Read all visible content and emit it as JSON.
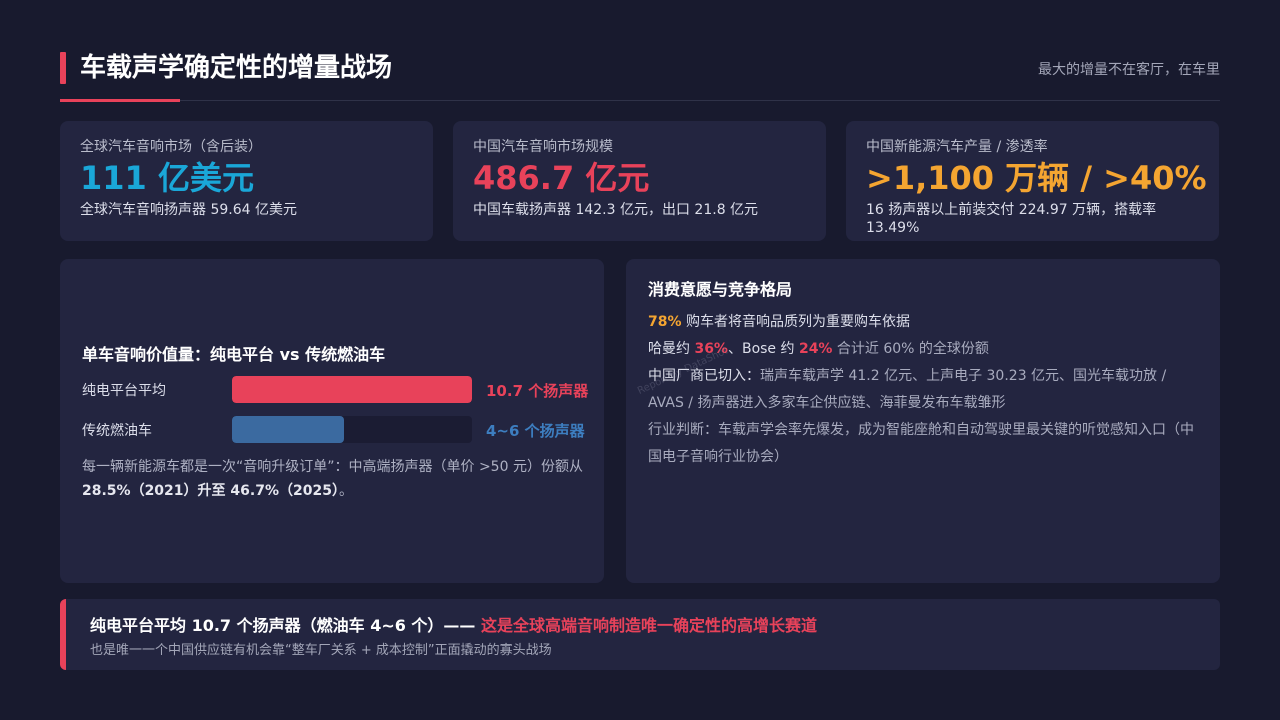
{
  "header": {
    "title": "车载声学确定性的增量战场",
    "subtitle": "最大的增量不在客厅，在车里"
  },
  "stats": [
    {
      "label": "全球汽车音响市场（含后装）",
      "value": "111 亿美元",
      "desc": "全球汽车音响扬声器 59.64 亿美元",
      "color": "#1aa7d8"
    },
    {
      "label": "中国汽车音响市场规模",
      "value": "486.7 亿元",
      "desc": "中国车载扬声器 142.3 亿元，出口 21.8 亿元",
      "color": "#e8425a"
    },
    {
      "label": "中国新能源汽车产量 / 渗透率",
      "value": ">1,100 万辆 / >40%",
      "desc": "16 扬声器以上前装交付 224.97 万辆，搭载率 13.49%",
      "color": "#f4a531"
    }
  ],
  "speaker_panel": {
    "title": "单车音响价值量：纯电平台 vs 传统燃油车",
    "bars": [
      {
        "label": "纯电平台平均",
        "value_text": "10.7 个扬声器",
        "value": 10.7,
        "color": "#e8425a"
      },
      {
        "label": "传统燃油车",
        "value_text": "4~6 个扬声器",
        "value": 5,
        "color": "#3b6aa0",
        "value_color": "#3d7ec0"
      }
    ],
    "note_prefix": "每一辆新能源车都是一次“音响升级订单”：中高端扬声器（单价 >50 元）份额从 ",
    "note_bold": "28.5%（2021）升至 46.7%（2025）",
    "note_suffix": "。"
  },
  "consumer_panel": {
    "title": "消费意愿与竞争格局",
    "line1_hl": "78%",
    "line1_text": " 购车者将音响品质列为重要购车依据",
    "line2_a": "哈曼约 ",
    "line2_b": "36%",
    "line2_c": "、Bose 约 ",
    "line2_d": "24%",
    "line2_e": " 合计近 60% 的全球份额",
    "line3_lead": "中国厂商已切入：",
    "line3_text": "瑞声车载声学 41.2 亿元、上声电子 30.23 亿元、国光车载功放 / AVAS / 扬声器进入多家车企供应链、海菲曼发布车载雏形",
    "line4": "行业判断：车载声学会率先爆发，成为智能座舱和自动驾驶里最关键的听觉感知入口（中国电子音响行业协会）"
  },
  "bottom": {
    "main": "纯电平台平均 10.7 个扬声器（燃油车 4~6 个）—— ",
    "main_hl": "这是全球高端音响制造唯一确定性的高增长赛道",
    "sub": "也是唯一一个中国供应链有机会靠“整车厂关系 + 成本控制”正面撬动的寡头战场"
  },
  "watermark": "Report by DataShot"
}
